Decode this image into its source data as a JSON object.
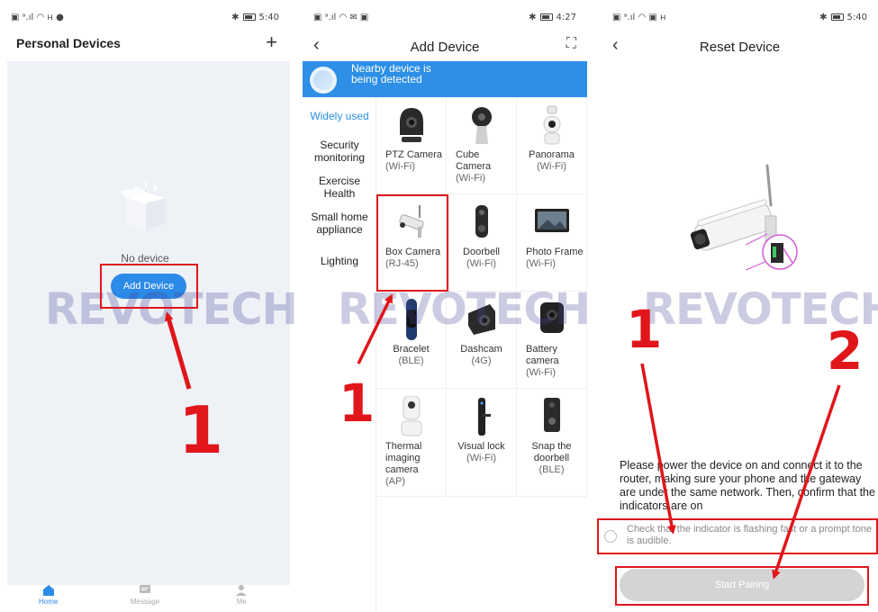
{
  "status": {
    "time_1": "5:40",
    "time_2": "4:27",
    "time_3": "5:40"
  },
  "screen1": {
    "title": "Personal Devices",
    "add_icon": "plus-icon",
    "empty_text": "No device",
    "add_button": "Add Device",
    "tabs": [
      {
        "label": "Home",
        "icon": "home-icon"
      },
      {
        "label": "Message",
        "icon": "message-icon"
      },
      {
        "label": "Me",
        "icon": "person-icon"
      }
    ]
  },
  "screen2": {
    "title": "Add Device",
    "scan_icon": "scan-icon",
    "banner_text": "Nearby device is being detected",
    "categories": [
      "Widely used",
      "Security monitoring",
      "Exercise Health",
      "Small home appliance",
      "Lighting"
    ],
    "devices": [
      {
        "name": "PTZ Camera",
        "sub": "(Wi-Fi)"
      },
      {
        "name": "Cube Camera",
        "sub": "(Wi-Fi)"
      },
      {
        "name": "Panorama",
        "sub": "(Wi-Fi)"
      },
      {
        "name": "Box Camera",
        "sub": "(RJ-45)"
      },
      {
        "name": "Doorbell",
        "sub": "(Wi-Fi)"
      },
      {
        "name": "Photo Frame",
        "sub": "(Wi-Fi)"
      },
      {
        "name": "Bracelet",
        "sub": "(BLE)"
      },
      {
        "name": "Dashcam",
        "sub": "(4G)"
      },
      {
        "name": "Battery camera",
        "sub": "(Wi-Fi)"
      },
      {
        "name": "Thermal imaging camera",
        "sub": "(AP)"
      },
      {
        "name": "Visual lock",
        "sub": "(Wi-Fi)"
      },
      {
        "name": "Snap the doorbell",
        "sub": "(BLE)"
      }
    ]
  },
  "screen3": {
    "title": "Reset Device",
    "instruction": "Please power the device on and connect it to the router, making sure your phone and the gateway are under the same network. Then, confirm that the indicators are on",
    "checkbox_text": "Check that the indicator is flashing fast or a prompt tone is audible.",
    "start_button": "Start Pairing"
  },
  "annotations": {
    "watermark": "REVOTECH",
    "step1": "1",
    "step2": "2",
    "highlight_color": "#e0161b"
  },
  "colors": {
    "primary": "#2c8ae8",
    "banner": "#2d8fe6",
    "empty_bg": "#eef2f7",
    "disabled_button": "#d4d4d4"
  }
}
